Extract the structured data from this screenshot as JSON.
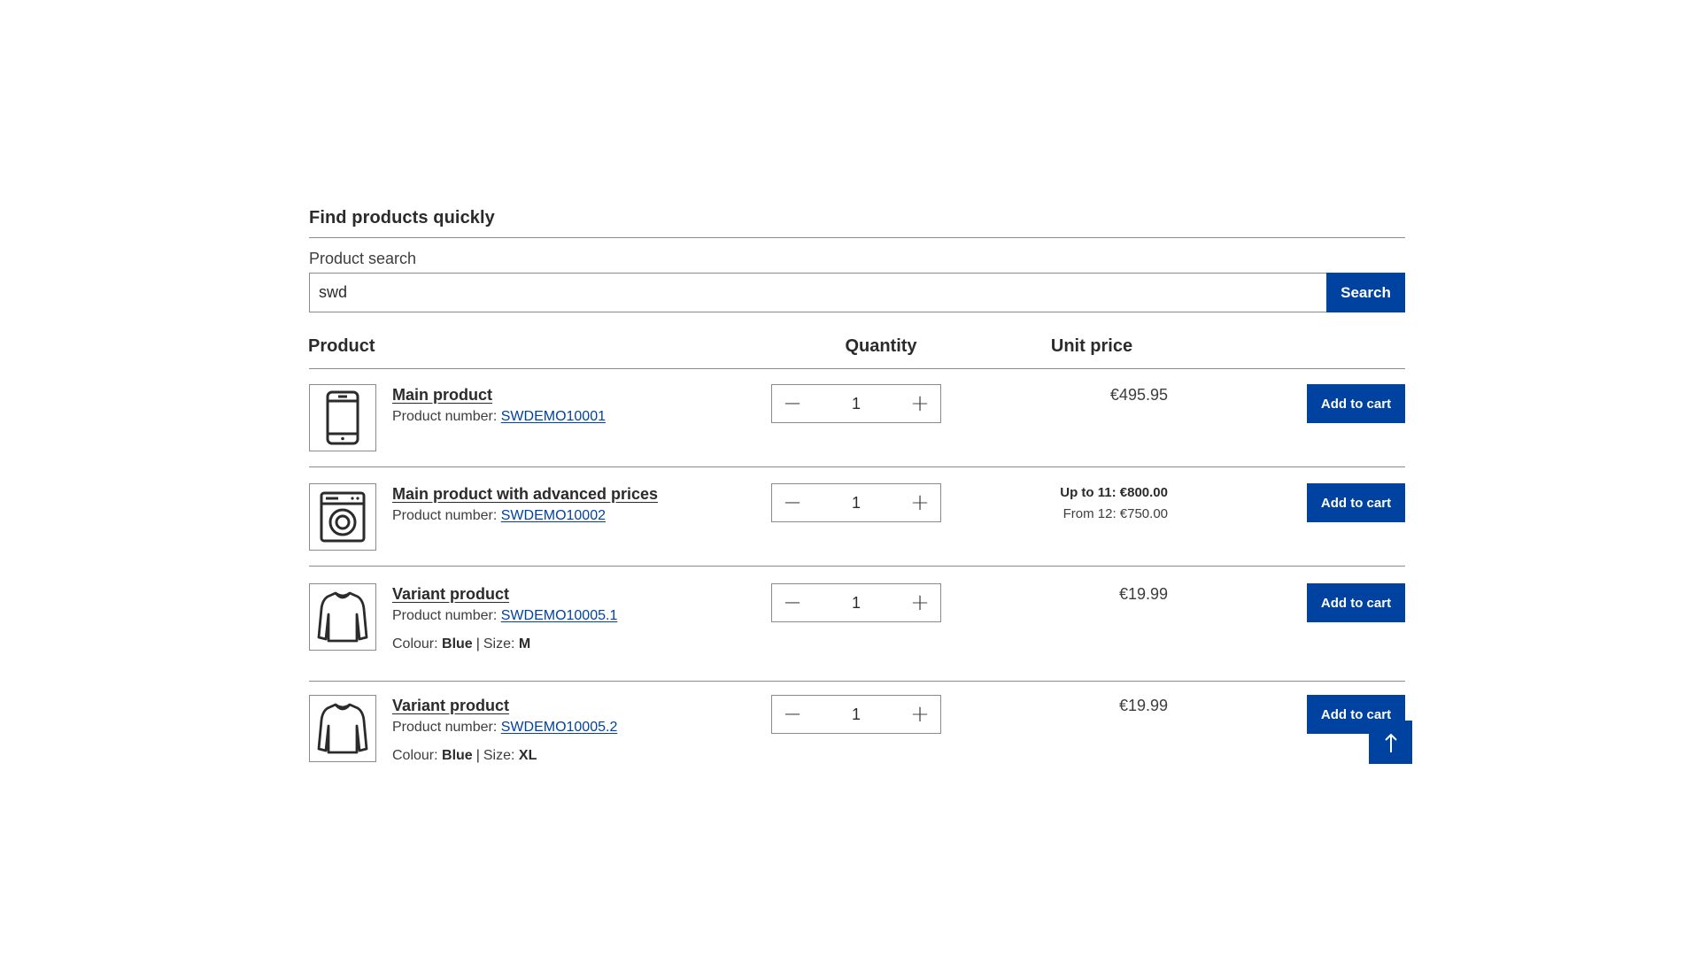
{
  "section": {
    "title": "Find products quickly"
  },
  "search": {
    "label": "Product search",
    "value": "swd",
    "button_label": "Search"
  },
  "table": {
    "headers": {
      "product": "Product",
      "quantity": "Quantity",
      "unit_price": "Unit price"
    },
    "number_prefix": "Product number:",
    "colour_label": "Colour:",
    "size_label": "Size:",
    "cart_label": "Add to cart",
    "rows": [
      {
        "name": "Main product",
        "number": "SWDEMO10001",
        "icon": "smartphone-icon",
        "quantity": "1",
        "price": "€495.95"
      },
      {
        "name": "Main product with advanced prices",
        "number": "SWDEMO10002",
        "icon": "washing-machine-icon",
        "quantity": "1",
        "price_tier_1": "Up to 11: €800.00",
        "price_tier_2": "From 12: €750.00"
      },
      {
        "name": "Variant product",
        "number": "SWDEMO10005.1",
        "icon": "sweater-icon",
        "quantity": "1",
        "price": "€19.99",
        "colour": "Blue",
        "size": "M"
      },
      {
        "name": "Variant product",
        "number": "SWDEMO10005.2",
        "icon": "sweater-icon",
        "quantity": "1",
        "price": "€19.99",
        "colour": "Blue",
        "size": "XL"
      }
    ]
  },
  "scroll_top": {
    "icon": "arrow-up-icon"
  },
  "colors": {
    "accent": "#0042a0",
    "text": "#2b2b2b",
    "border": "#8a8a8a"
  }
}
